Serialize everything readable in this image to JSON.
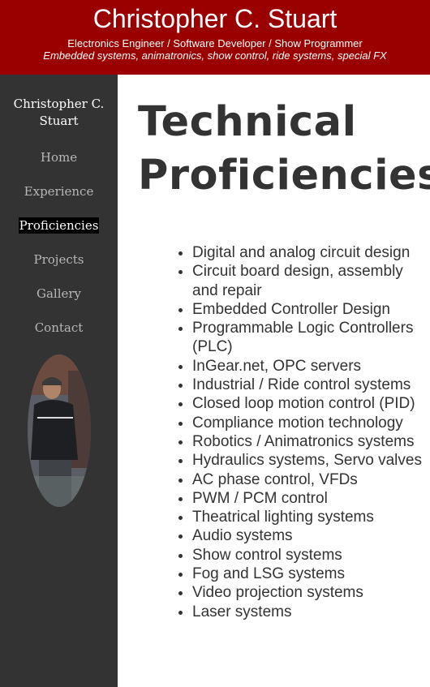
{
  "header": {
    "title": "Christopher C. Stuart",
    "tagline": "Electronics Engineer / Software Developer / Show Programmer",
    "specialties": "Embedded systems, animatronics, show control, ride systems, special FX"
  },
  "sidebar": {
    "name": "Christopher C. Stuart",
    "nav": [
      {
        "label": "Home"
      },
      {
        "label": "Experience"
      },
      {
        "label": "Proficiencies"
      },
      {
        "label": "Projects"
      },
      {
        "label": "Gallery"
      },
      {
        "label": "Contact"
      }
    ],
    "active_index": 2
  },
  "main": {
    "title": "Technical Proficiencies",
    "skills": [
      "Digital and analog circuit design",
      "Circuit board design, assembly and repair",
      "Embedded Controller Design",
      "Programmable Logic Controllers (PLC)",
      "InGear.net, OPC servers",
      "Industrial / Ride control systems",
      "Closed loop motion control (PID)",
      "Compliance motion technology",
      "Robotics / Animatronics systems",
      "Hydraulics systems, Servo valves",
      "AC phase control, VFDs",
      "PWM / PCM control",
      "Theatrical lighting systems",
      "Audio systems",
      "Show control systems",
      "Fog and LSG systems",
      "Video projection systems",
      "Laser systems"
    ]
  },
  "colors": {
    "header_bg": "#9b0000",
    "sidebar_bg": "#333333",
    "nav_text": "#b7b7b7",
    "body_text": "#333333"
  }
}
